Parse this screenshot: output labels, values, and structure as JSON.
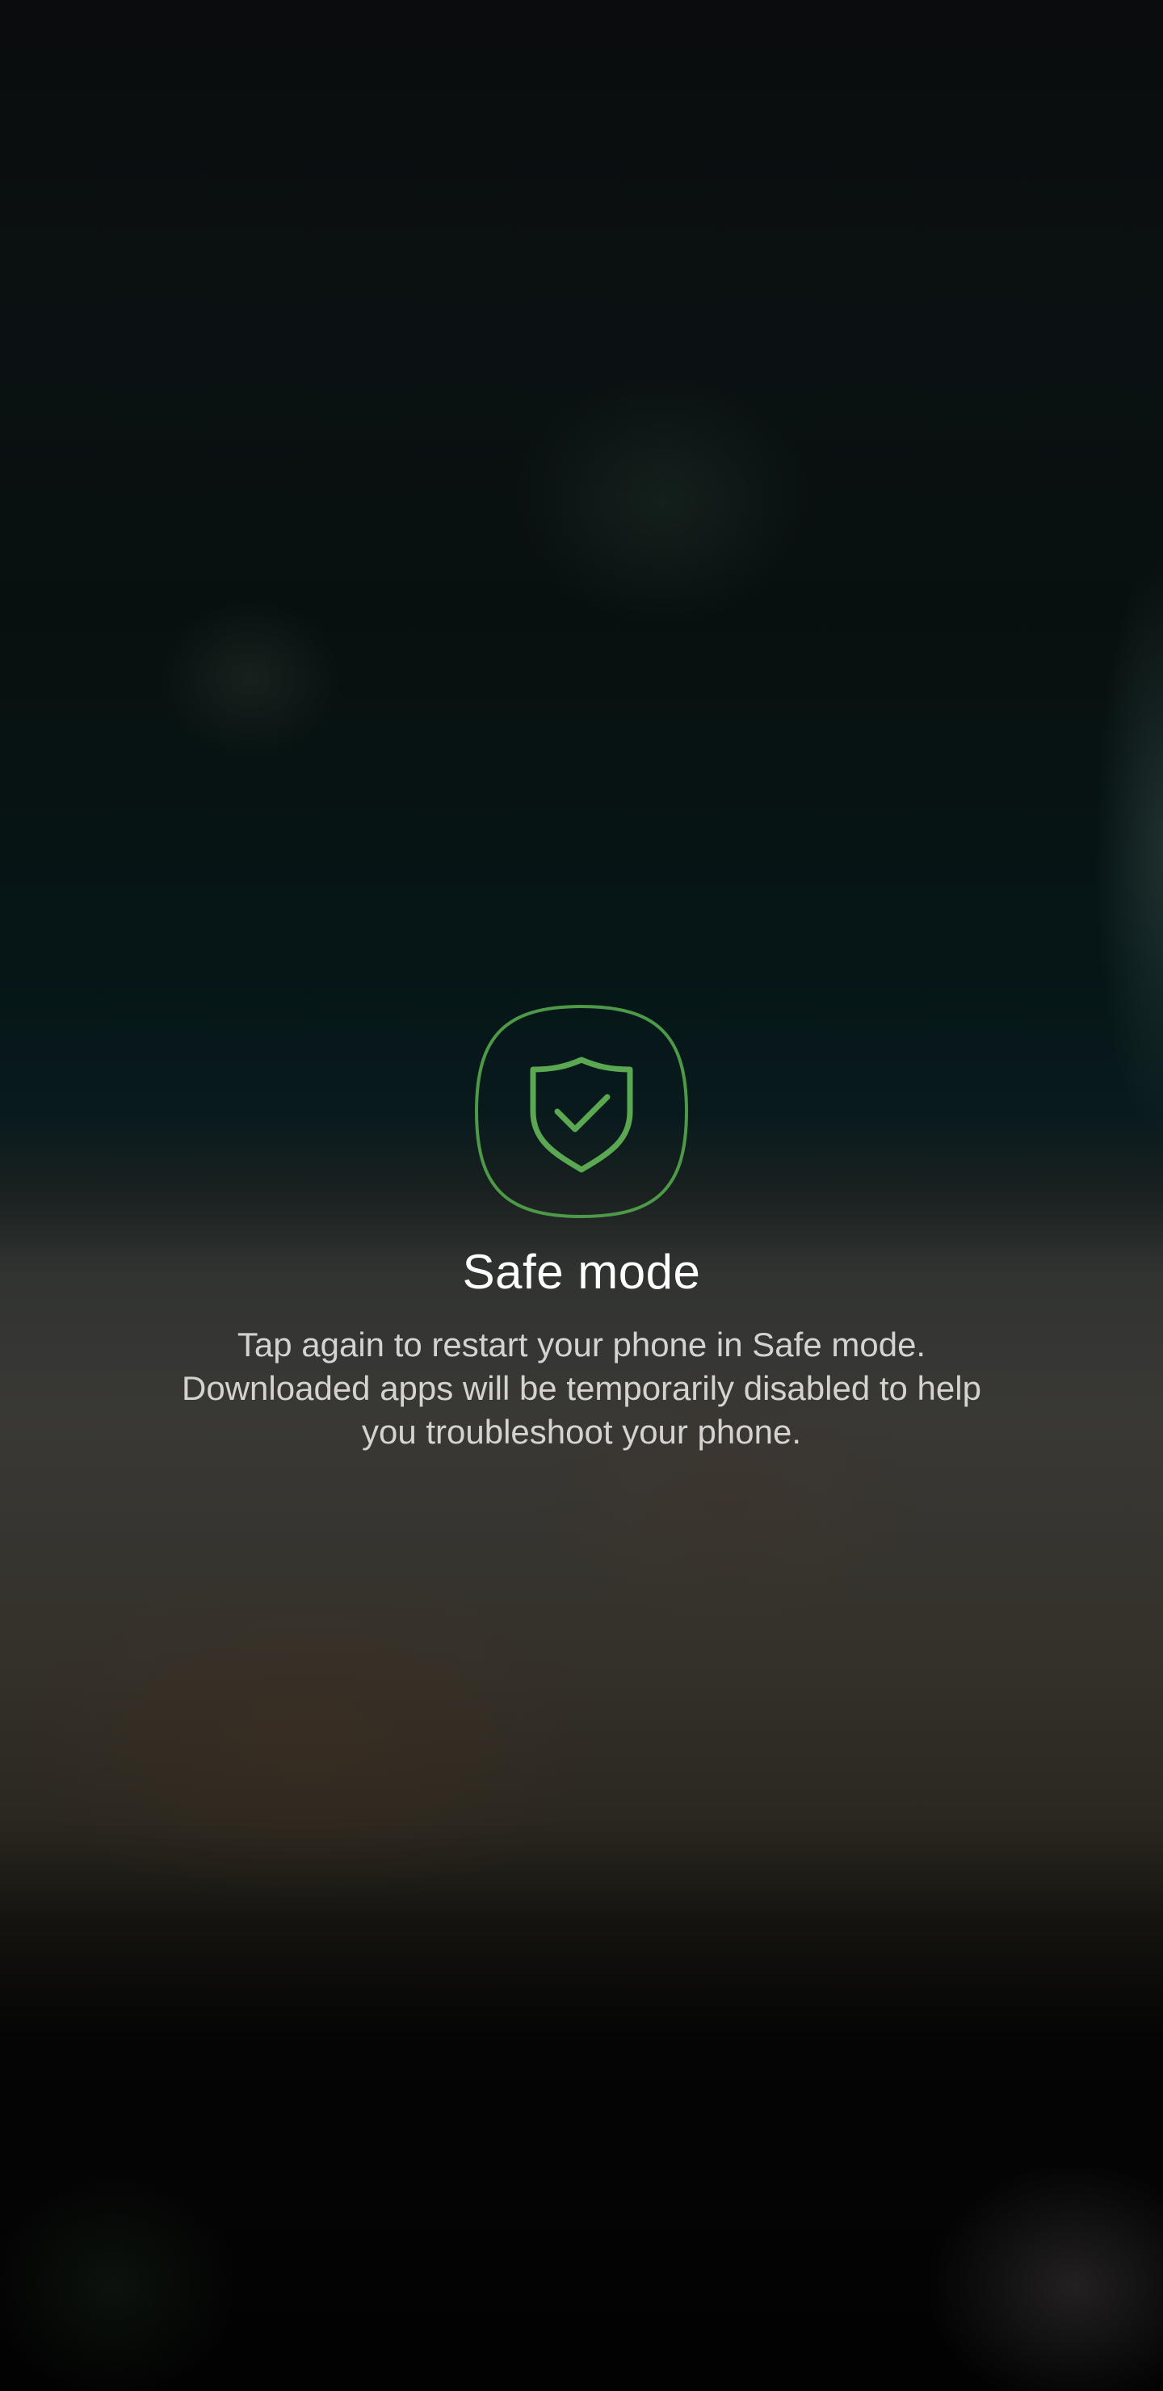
{
  "safe_mode": {
    "icon": "shield-check-icon",
    "title": "Safe mode",
    "description": "Tap again to restart your phone in Safe mode. Downloaded apps will be temporarily disabled to help you troubleshoot your phone.",
    "accent_color": "#5aa952"
  }
}
